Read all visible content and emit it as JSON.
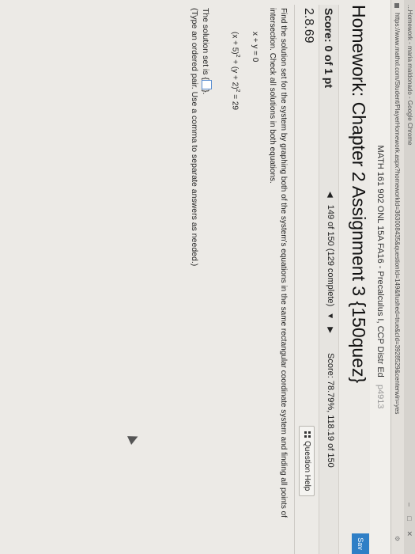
{
  "browser": {
    "title": "...Homework - maria maldonado - Google Chrome",
    "url": "https://www.mathxl.com/Student/PlayerHomework.aspx?homeworkId=363008435&questionId=149&flushed=true&cId=3928529&centerwin=yes"
  },
  "course": {
    "title": "MATH 161 902 ONL 15A FA16 - Precalculus I, CCP Distr Ed",
    "extra": "p4913"
  },
  "header": {
    "homework_title": "Homework: Chapter 2 Assignment 3 {150quez}",
    "save_label": "Sav",
    "score_label": "Score: 0 of 1 pt",
    "nav_text": "149 of 150 (129 complete)",
    "hw_score": "Score: 78.79%, 118.19 of 150"
  },
  "question": {
    "number": "2.8.69",
    "help_label": "Question Help",
    "instructions": "Find the solution set for the system by graphing both of the system's equations in the same rectangular coordinate system and finding all points of intersection. Check all solutions in both equations.",
    "eq1": "x + y = 0",
    "eq2_part1": "(x + 5)",
    "eq2_exp1": "2",
    "eq2_part2": " + (y + 2)",
    "eq2_exp2": "2",
    "eq2_part3": " = 29",
    "answer_prefix": "The solution set is {",
    "answer_suffix": "}.",
    "answer_note": "(Type an ordered pair. Use a comma to separate answers as needed.)"
  }
}
